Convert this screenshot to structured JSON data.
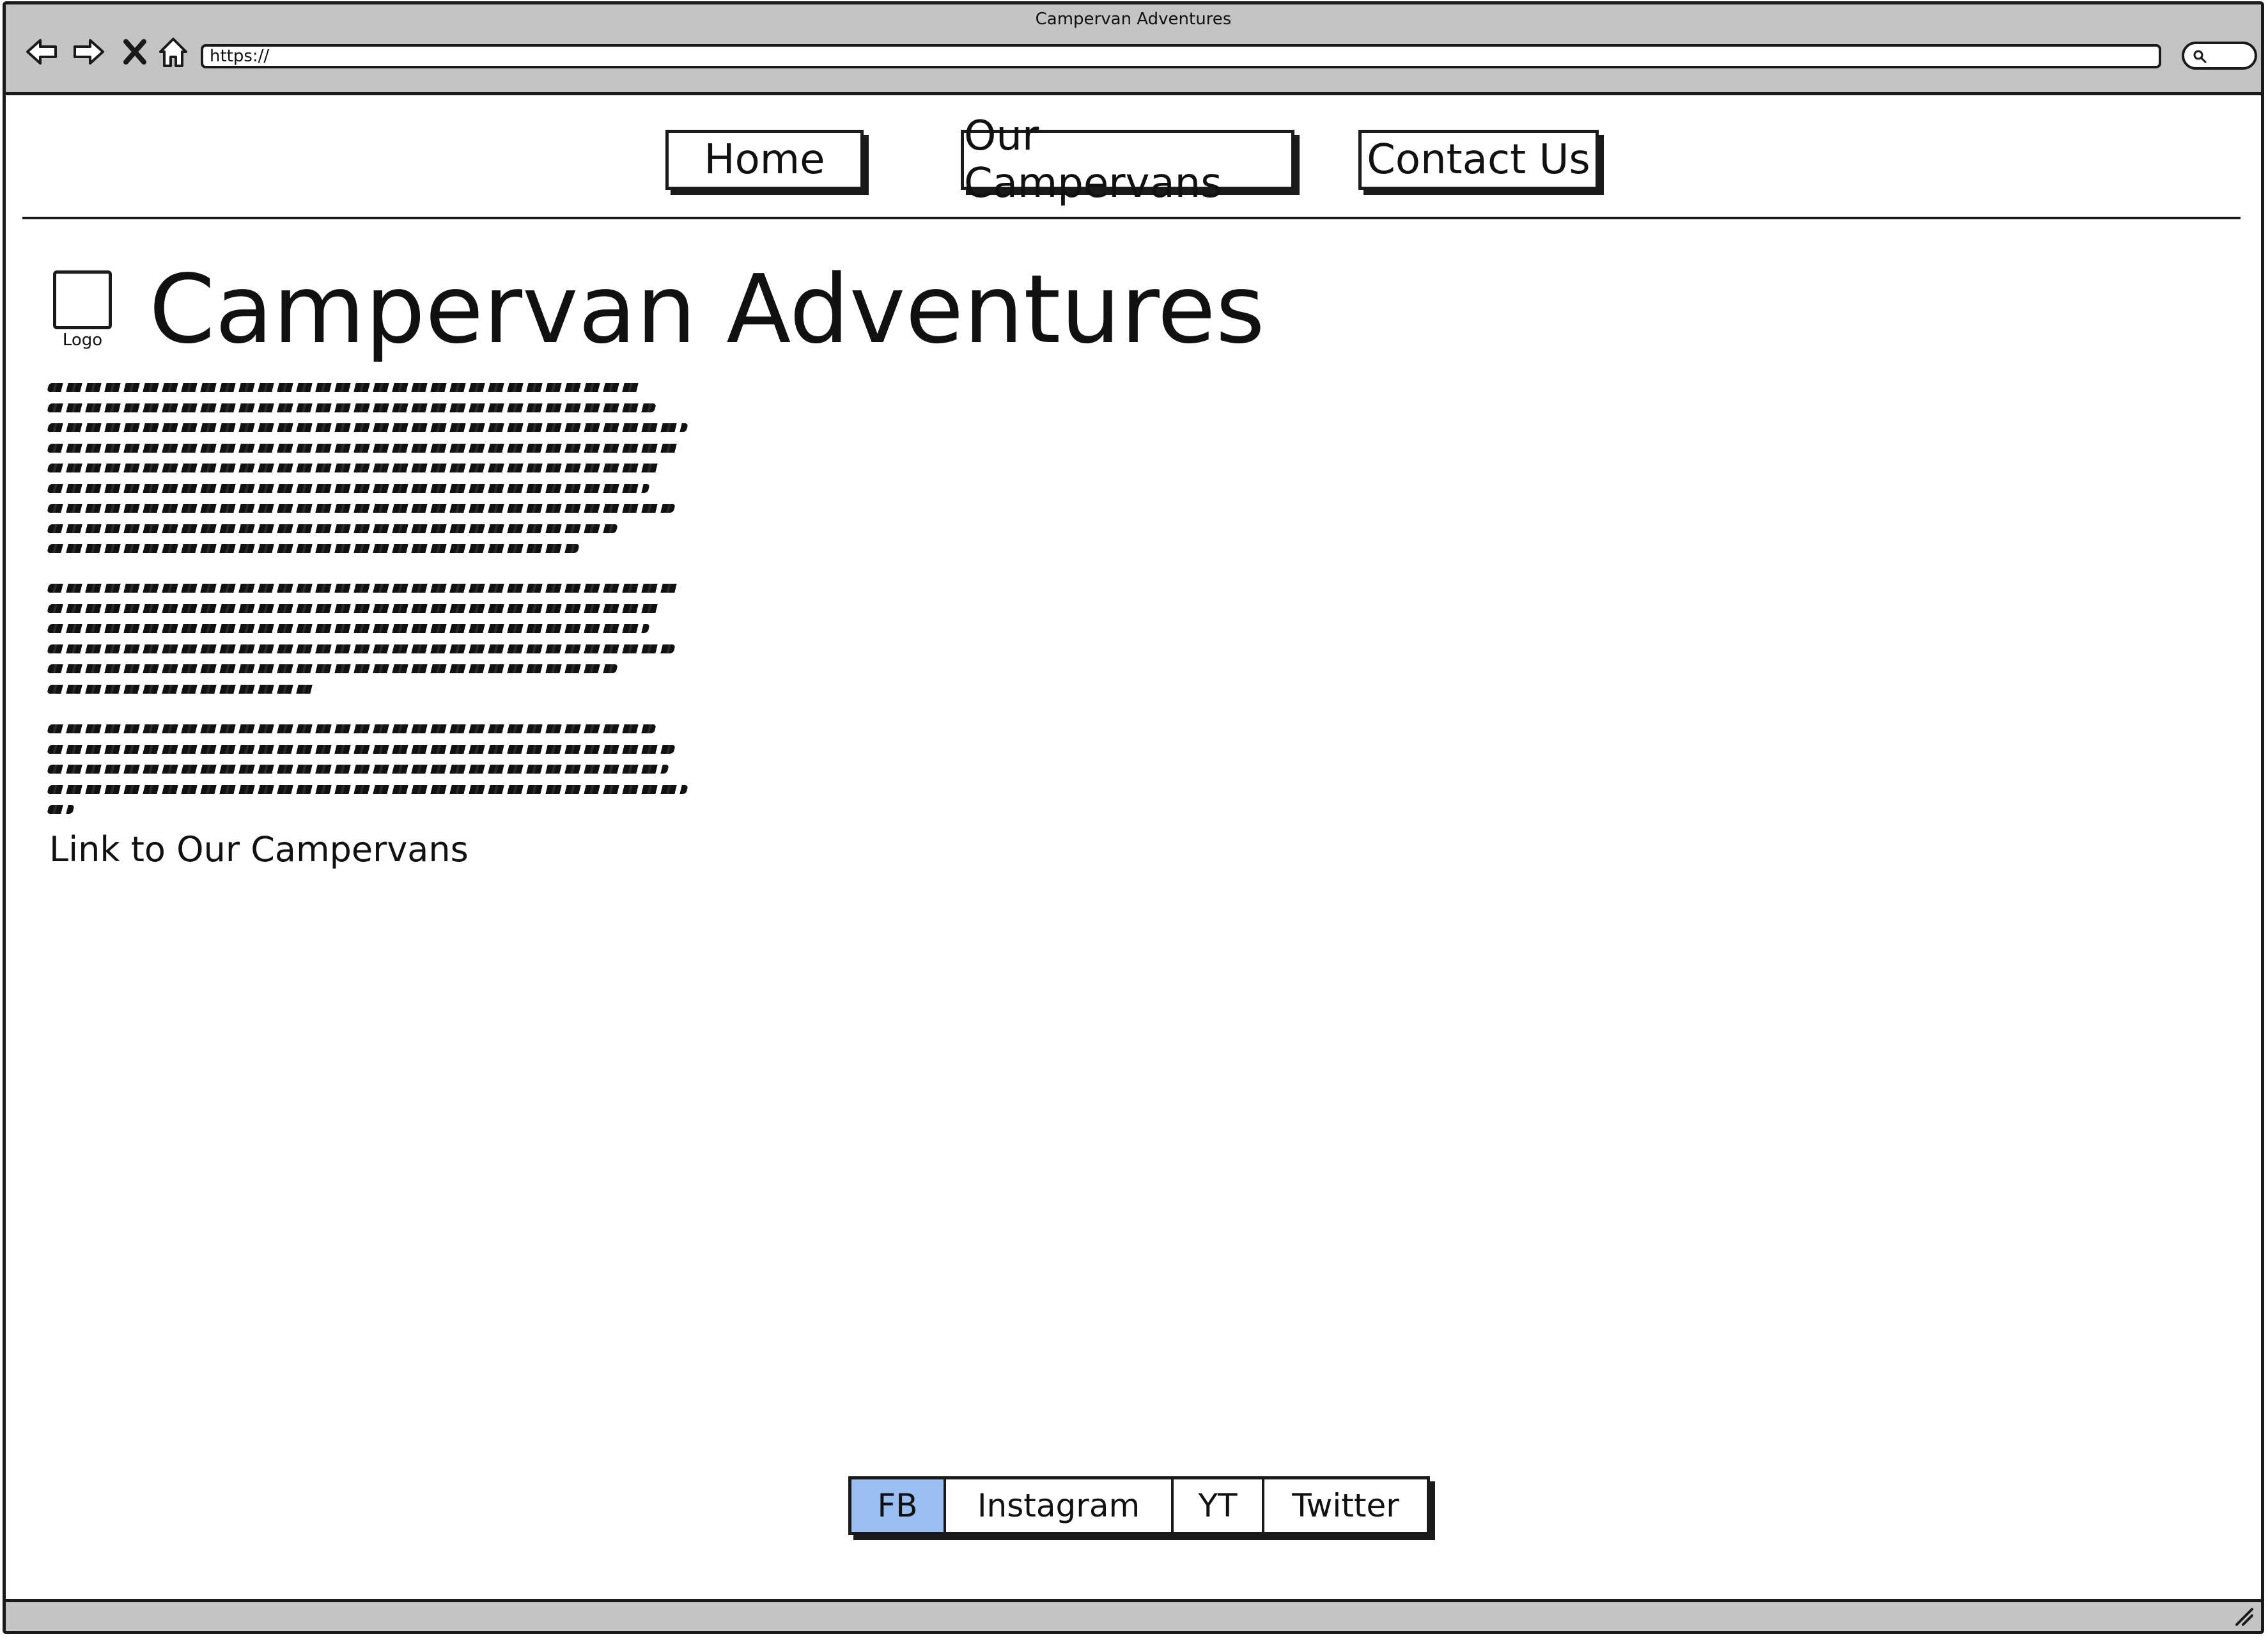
{
  "window": {
    "title": "Campervan Adventures"
  },
  "toolbar": {
    "back_icon": "back-arrow-icon",
    "forward_icon": "forward-arrow-icon",
    "stop_icon": "close-icon",
    "home_icon": "home-icon",
    "url": "https://",
    "search_icon": "search-icon"
  },
  "nav": {
    "items": [
      {
        "label": "Home"
      },
      {
        "label": "Our Campervans"
      },
      {
        "label": "Contact Us"
      }
    ]
  },
  "header": {
    "logo_label": "Logo",
    "title": "Campervan Adventures"
  },
  "content": {
    "link_text": "Link to Our Campervans"
  },
  "footer": {
    "social_tabs": [
      {
        "label": "FB",
        "selected": true
      },
      {
        "label": "Instagram",
        "selected": false
      },
      {
        "label": "YT",
        "selected": false
      },
      {
        "label": "Twitter",
        "selected": false
      }
    ]
  },
  "colors": {
    "chrome": "#c4c4c4",
    "selected_tab": "#9abff2",
    "ink": "#1a1a1a"
  }
}
